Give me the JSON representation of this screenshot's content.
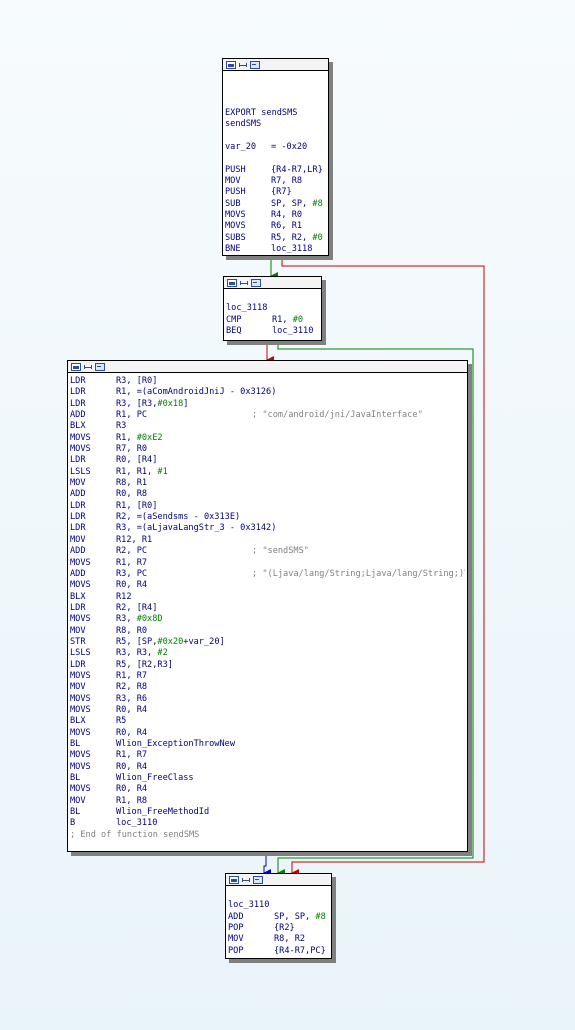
{
  "header_icons": [
    "graph-icon",
    "group-icon",
    "hex-icon"
  ],
  "blocks": {
    "b1": {
      "lines": [
        {
          "t": ""
        },
        {
          "t": ""
        },
        {
          "t": ""
        },
        {
          "t": "EXPORT sendSMS"
        },
        {
          "t": "sendSMS"
        },
        {
          "t": ""
        },
        {
          "m": "var_20",
          "o": "= -0x20"
        },
        {
          "t": ""
        },
        {
          "m": "PUSH",
          "o": "{R4-R7,LR}"
        },
        {
          "m": "MOV",
          "o": "R7, R8"
        },
        {
          "m": "PUSH",
          "o": "{R7}"
        },
        {
          "m": "SUB",
          "o": "SP, SP, #8"
        },
        {
          "m": "MOVS",
          "o": "R4, R0"
        },
        {
          "m": "MOVS",
          "o": "R6, R1"
        },
        {
          "m": "SUBS",
          "o": "R5, R2, #0"
        },
        {
          "m": "BNE",
          "o": "loc_3118"
        }
      ]
    },
    "b2": {
      "lines": [
        {
          "t": ""
        },
        {
          "t": "loc_3118"
        },
        {
          "m": "CMP",
          "o": "R1, #0"
        },
        {
          "m": "BEQ",
          "o": "loc_3110"
        }
      ]
    },
    "b3": {
      "lines": [
        {
          "m": "LDR",
          "o": "R3, [R0]"
        },
        {
          "m": "LDR",
          "o": "R1, =(aComAndroidJniJ - 0x3126)"
        },
        {
          "m": "LDR",
          "o": "R3, [R3,#0x18]"
        },
        {
          "m": "ADD",
          "o": "R1, PC",
          "c": "; \"com/android/jni/JavaInterface\""
        },
        {
          "m": "BLX",
          "o": "R3"
        },
        {
          "m": "MOVS",
          "o": "R1, #0xE2"
        },
        {
          "m": "MOVS",
          "o": "R7, R0"
        },
        {
          "m": "LDR",
          "o": "R0, [R4]"
        },
        {
          "m": "LSLS",
          "o": "R1, R1, #1"
        },
        {
          "m": "MOV",
          "o": "R8, R1"
        },
        {
          "m": "ADD",
          "o": "R0, R8"
        },
        {
          "m": "LDR",
          "o": "R1, [R0]"
        },
        {
          "m": "LDR",
          "o": "R2, =(aSendsms - 0x313E)"
        },
        {
          "m": "LDR",
          "o": "R3, =(aLjavaLangStr_3 - 0x3142)"
        },
        {
          "m": "MOV",
          "o": "R12, R1"
        },
        {
          "m": "ADD",
          "o": "R2, PC",
          "c": "; \"sendSMS\""
        },
        {
          "m": "MOVS",
          "o": "R1, R7"
        },
        {
          "m": "ADD",
          "o": "R3, PC",
          "c": "; \"(Ljava/lang/String;Ljava/lang/String;)V\"..."
        },
        {
          "m": "MOVS",
          "o": "R0, R4"
        },
        {
          "m": "BLX",
          "o": "R12"
        },
        {
          "m": "LDR",
          "o": "R2, [R4]"
        },
        {
          "m": "MOVS",
          "o": "R3, #0x8D"
        },
        {
          "m": "MOV",
          "o": "R8, R0"
        },
        {
          "m": "STR",
          "o": "R5, [SP,#0x20+var_20]"
        },
        {
          "m": "LSLS",
          "o": "R3, R3, #2"
        },
        {
          "m": "LDR",
          "o": "R5, [R2,R3]"
        },
        {
          "m": "MOVS",
          "o": "R1, R7"
        },
        {
          "m": "MOV",
          "o": "R2, R8"
        },
        {
          "m": "MOVS",
          "o": "R3, R6"
        },
        {
          "m": "MOVS",
          "o": "R0, R4"
        },
        {
          "m": "BLX",
          "o": "R5"
        },
        {
          "m": "MOVS",
          "o": "R0, R4"
        },
        {
          "m": "BL",
          "o": "Wlion_ExceptionThrowNew"
        },
        {
          "m": "MOVS",
          "o": "R1, R7"
        },
        {
          "m": "MOVS",
          "o": "R0, R4"
        },
        {
          "m": "BL",
          "o": "Wlion_FreeClass"
        },
        {
          "m": "MOVS",
          "o": "R0, R4"
        },
        {
          "m": "MOV",
          "o": "R1, R8"
        },
        {
          "m": "BL",
          "o": "Wlion_FreeMethodId"
        },
        {
          "m": "B",
          "o": "loc_3110"
        },
        {
          "t": "; End of function sendSMS",
          "cls": "c"
        }
      ]
    },
    "b4": {
      "lines": [
        {
          "t": ""
        },
        {
          "t": "loc_3110"
        },
        {
          "m": "ADD",
          "o": "SP, SP, #8"
        },
        {
          "m": "POP",
          "o": "{R2}"
        },
        {
          "m": "MOV",
          "o": "R8, R2"
        },
        {
          "m": "POP",
          "o": "{R4-R7,PC}"
        }
      ]
    }
  },
  "edge_colors": {
    "taken": "#008000",
    "not_taken": "#cc0000",
    "unconditional": "#0000cc"
  }
}
